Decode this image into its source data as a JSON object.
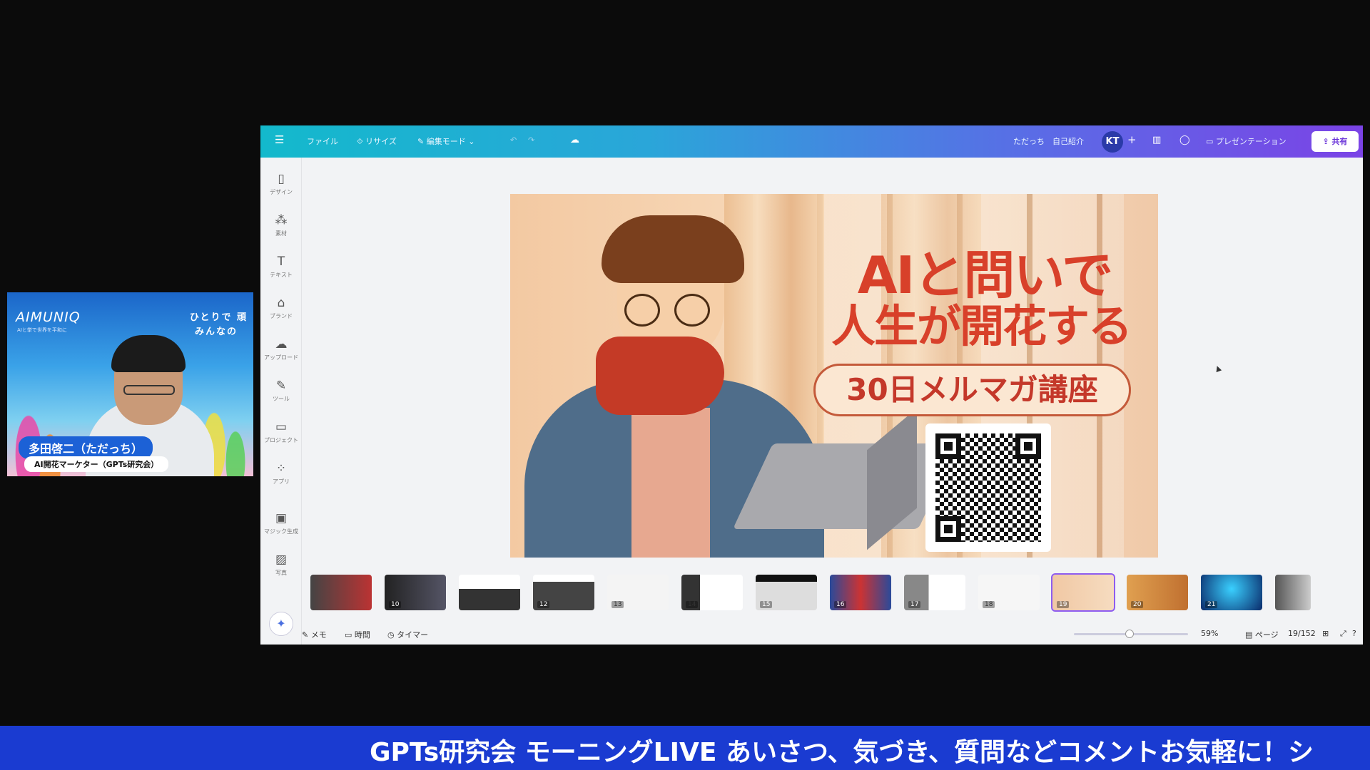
{
  "webcam": {
    "brand": "AIMUNIQ",
    "brand_tagline": "AIと挙で世界を平和に",
    "tagline_line1": "ひとりで 頑",
    "tagline_line2": "みんなの",
    "presenter_name": "多田啓二（ただっち）",
    "presenter_role": "AI開花マーケター（GPTs研究会）"
  },
  "topbar": {
    "menu_icon": "hamburger-icon",
    "file_label": "ファイル",
    "resize_label": "リサイズ",
    "edit_mode_label": "編集モード",
    "user_label": "ただっち",
    "doc_title": "自己紹介",
    "avatar_initials": "KT",
    "present_label": "プレゼンテーション",
    "share_label": "共有"
  },
  "sidebar": {
    "items": [
      {
        "label": "デザイン",
        "icon": "design-icon"
      },
      {
        "label": "素材",
        "icon": "elements-icon"
      },
      {
        "label": "テキスト",
        "icon": "text-icon"
      },
      {
        "label": "ブランド",
        "icon": "brand-icon"
      },
      {
        "label": "アップロード",
        "icon": "upload-icon"
      },
      {
        "label": "ツール",
        "icon": "draw-icon"
      },
      {
        "label": "プロジェクト",
        "icon": "folder-icon"
      },
      {
        "label": "アプリ",
        "icon": "apps-icon"
      },
      {
        "label": "マジック生成",
        "icon": "magic-media-icon"
      },
      {
        "label": "写真",
        "icon": "photos-icon"
      }
    ]
  },
  "slide": {
    "title_line1": "AIと問いで",
    "title_line2": "人生が開花する",
    "course_label": "30日メルマガ講座"
  },
  "filmstrip": {
    "pages": [
      "",
      "10",
      "",
      "12",
      "13",
      "14",
      "15",
      "16",
      "17",
      "18",
      "19",
      "20",
      "21",
      ""
    ],
    "selected_index": 10
  },
  "bottombar": {
    "notes_label": "メモ",
    "timer_label_1": "時間",
    "timer_label_2": "タイマー",
    "zoom_value": "59%",
    "pages_label": "ページ",
    "page_counter": "19/152"
  },
  "ticker": {
    "text": "GPTs研究会 モーニングLIVE あいさつ、気づき、質問などコメントお気軽に！シ"
  },
  "colors": {
    "topbar_start": "#13b9cc",
    "topbar_end": "#7b43e6",
    "slide_title": "#d8402a",
    "ticker_bg": "#1a3bd1",
    "presenter_badge": "#1c61d6"
  }
}
